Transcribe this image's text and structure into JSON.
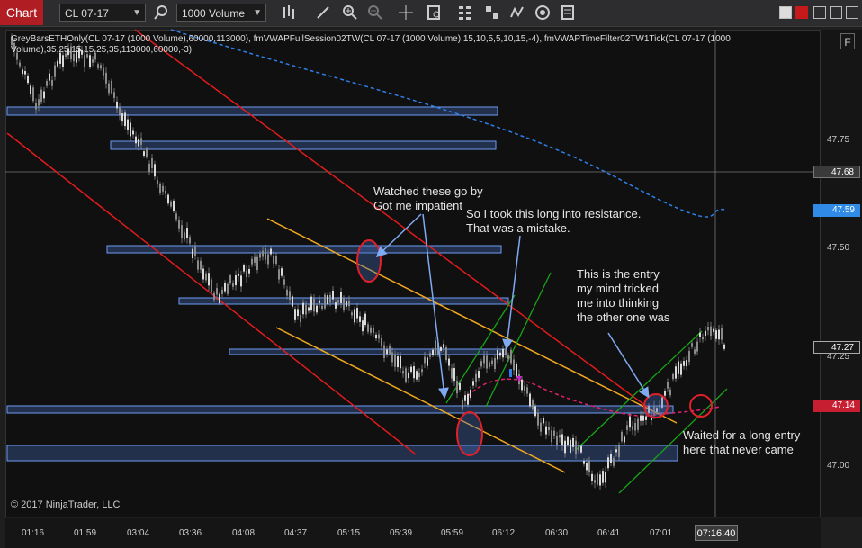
{
  "app": {
    "chart_tab": "Chart",
    "instrument": "CL 07-17",
    "interval": "1000 Volume",
    "toolbar_icons": [
      "search-icon",
      "bar-type-icon",
      "draw-pencil-icon",
      "zoom-in-icon",
      "zoom-out-icon",
      "crosshair-icon",
      "data-box-icon",
      "strategy-icon",
      "properties-icon",
      "chart-style-icon",
      "indicator-icon",
      "template-icon",
      "menu-icon"
    ]
  },
  "indicator_line": "GreyBarsETHOnly(CL 07-17 (1000 Volume),60000,113000), fmVWAPFullSession02TW(CL 07-17 (1000 Volume),15,10,5,5,10,15,-4), fmVWAPTimeFilter02TW1Tick(CL 07-17 (1000 Volume),35,25,15,15,25,35,113000,60000,-3)",
  "f_label": "F",
  "annotations": {
    "watched": "Watched these go by\nGot me impatient",
    "took_long": "So I took this long into resistance.\nThat was a mistake.",
    "entry": "This is the entry\nmy mind tricked\nme into thinking\nthe other one was",
    "waited": "Waited for a long entry\nhere that never came"
  },
  "copyright": "© 2017 NinjaTrader, LLC",
  "price_axis": {
    "labels": [
      "47.75",
      "47.50",
      "47.25",
      "47.00"
    ],
    "tags": {
      "crosshair": "47.68",
      "vwap": "47.59",
      "last": "47.27",
      "level": "47.14"
    }
  },
  "time_axis": {
    "labels": [
      "01:16",
      "01:59",
      "03:04",
      "03:36",
      "04:08",
      "04:37",
      "05:15",
      "05:39",
      "05:59",
      "06:12",
      "06:30",
      "06:41",
      "07:01"
    ],
    "current": "07:16:40"
  },
  "colors": {
    "up": "#d9d9d9",
    "down": "#8a8a8a",
    "zone_fill": "rgba(70,110,190,0.35)",
    "zone_edge": "#6d9cf2",
    "red_channel": "#e01b1b",
    "orange_channel": "#f0a81e",
    "green_channel": "#17a517",
    "vwap_blue": "#2f7fe8",
    "circle": "#e0202a",
    "last_tag": "#1a1a1a",
    "vwap_tag": "#2f8be6",
    "level_tag": "#c81e32"
  }
}
